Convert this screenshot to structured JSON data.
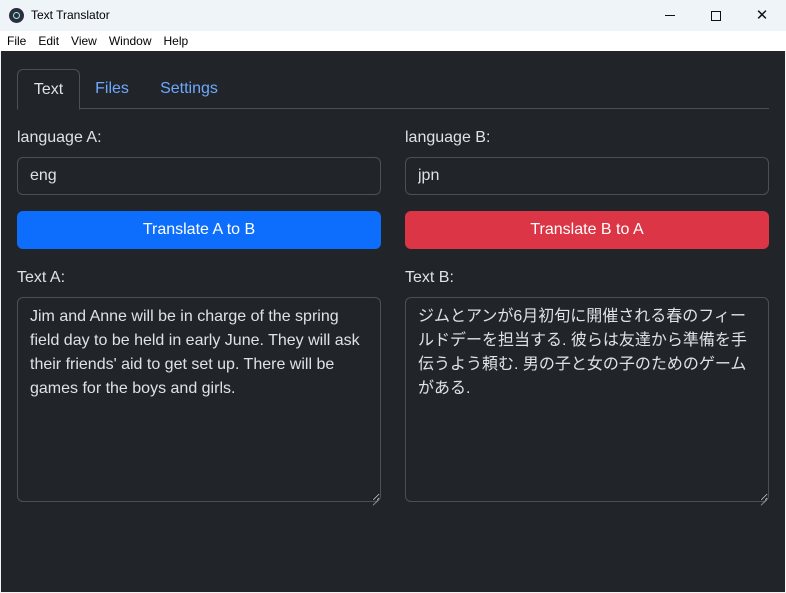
{
  "window": {
    "title": "Text Translator",
    "minimize_glyph": "—",
    "maximize_glyph": "□",
    "close_glyph": "✕"
  },
  "menu": [
    "File",
    "Edit",
    "View",
    "Window",
    "Help"
  ],
  "tabs": [
    "Text",
    "Files",
    "Settings"
  ],
  "left": {
    "lang_label": "language A:",
    "lang_value": "eng",
    "button": "Translate A to B",
    "text_label": "Text A:",
    "text_value": "Jim and Anne will be in charge of the spring field day to be held in early June. They will ask their friends' aid to get set up. There will be games for the boys and girls."
  },
  "right": {
    "lang_label": "language B:",
    "lang_value": "jpn",
    "button": "Translate B to A",
    "text_label": "Text B:",
    "text_value": "ジムとアンが6月初旬に開催される春のフィールドデーを担当する. 彼らは友達から準備を手伝うよう頼む. 男の子と女の子のためのゲームがある."
  },
  "colors": {
    "primary": "#0d6efd",
    "danger": "#dc3545",
    "background": "#212529",
    "link": "#6ea8fe"
  }
}
